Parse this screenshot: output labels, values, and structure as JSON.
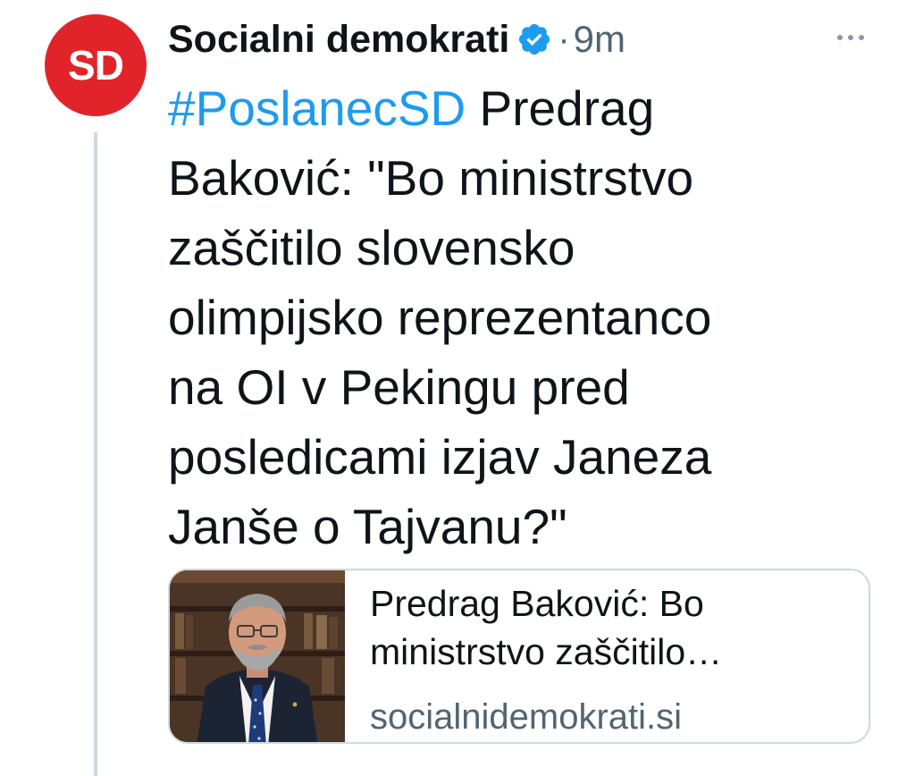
{
  "tweet": {
    "avatar_text": "SD",
    "avatar_color": "#e0242a",
    "display_name": "Socialni demokrati",
    "verified_icon": "verified-badge-icon",
    "separator": "·",
    "time": "9m",
    "more_icon": "more-options-icon",
    "text": {
      "hashtag": "#PoslanecSD",
      "line1_rest": " Predrag",
      "lines": [
        "Baković: \"Bo ministrstvo",
        "zaščitilo slovensko",
        "olimpijsko reprezentanco",
        "na OI v Pekingu pred",
        "posledicami izjav Janeza",
        "Janše o Tajvanu?\""
      ]
    },
    "link_card": {
      "title_lines": [
        "Predrag Baković: Bo",
        "ministrstvo zaščitilo…"
      ],
      "domain": "socialnidemokrati.si",
      "thumbnail": "portrait-photo"
    }
  },
  "colors": {
    "link_blue": "#1d9bf0",
    "secondary_text": "#536471",
    "border": "#cfd9de"
  }
}
